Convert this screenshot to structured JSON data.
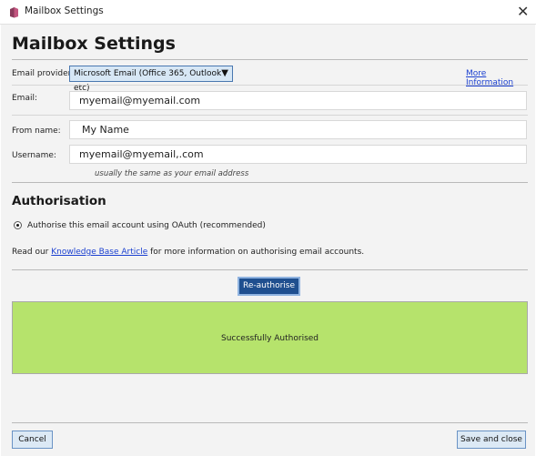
{
  "window": {
    "title": "Mailbox Settings",
    "close_glyph": "✕",
    "icon": "app-icon"
  },
  "heading": "Mailbox Settings",
  "provider": {
    "label": "Email provider:",
    "value": "Microsoft Email (Office 365, Outlook etc)",
    "more_info": "More Information"
  },
  "email": {
    "label": "Email:",
    "value": "myemail@myemail.com"
  },
  "from_name": {
    "label": "From name:",
    "value": "My Name"
  },
  "username": {
    "label": "Username:",
    "value": "myemail@myemail,.com",
    "hint": "usually the same as your email address"
  },
  "authorisation": {
    "title": "Authorisation",
    "oauth_option": "Authorise this email account using OAuth (recommended)",
    "read_prefix": "Read our",
    "kb_link": "Knowledge Base Article",
    "read_suffix": "for more information on authorising email accounts.",
    "reauth_button": "Re-authorise",
    "status": "Successfully Authorised"
  },
  "footer": {
    "cancel": "Cancel",
    "save": "Save and close"
  },
  "colors": {
    "success": "#b6e36c",
    "primary_button": "#1f4f8f",
    "link": "#1a3fd0"
  }
}
